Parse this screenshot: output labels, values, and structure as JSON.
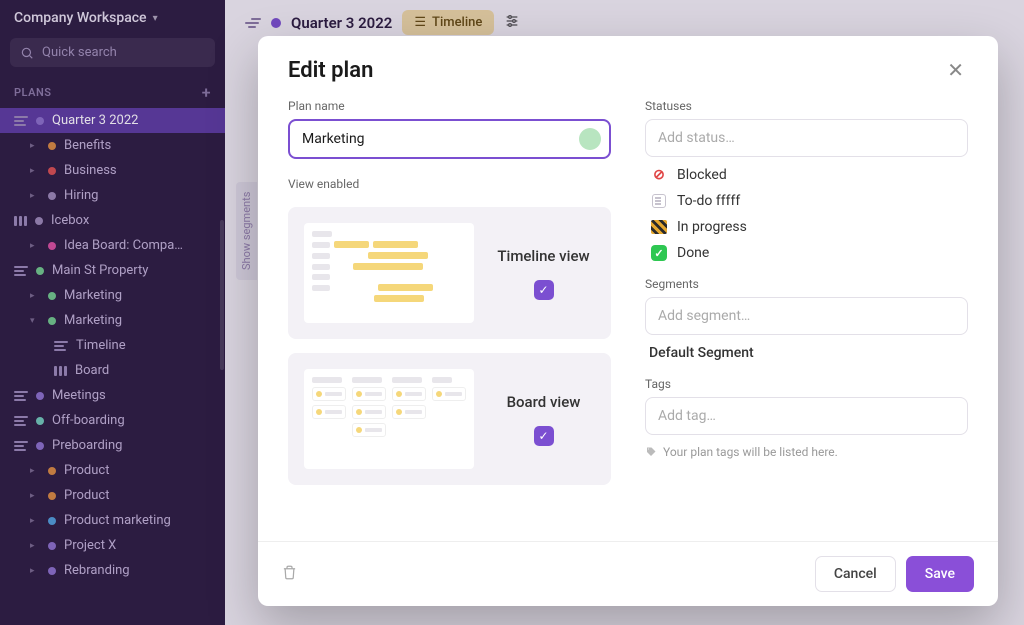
{
  "workspace": {
    "name": "Company Workspace",
    "search_placeholder": "Quick search"
  },
  "sidebar": {
    "plans_label": "PLANS",
    "items": [
      {
        "name": "Quarter 3 2022",
        "kind": "list",
        "color": "#8a6fc9",
        "active": true,
        "depth": 0
      },
      {
        "name": "Benefits",
        "kind": "dot",
        "color": "#d98a3e",
        "depth": 1
      },
      {
        "name": "Business",
        "kind": "dot",
        "color": "#d94e4e",
        "depth": 1
      },
      {
        "name": "Hiring",
        "kind": "dot",
        "color": "#9a88b5",
        "depth": 1
      },
      {
        "name": "Icebox",
        "kind": "board",
        "color": "#9a88b5",
        "depth": 0
      },
      {
        "name": "Idea Board: Compa…",
        "kind": "dot",
        "color": "#d94e9e",
        "depth": 1
      },
      {
        "name": "Main St Property",
        "kind": "list",
        "color": "#6fc98a",
        "depth": 0
      },
      {
        "name": "Marketing",
        "kind": "dot",
        "color": "#6fc98a",
        "depth": 1
      },
      {
        "name": "Marketing",
        "kind": "dot",
        "color": "#6fc98a",
        "depth": 1,
        "expanded": true
      },
      {
        "name": "Timeline",
        "kind": "list",
        "color": "",
        "depth": 2
      },
      {
        "name": "Board",
        "kind": "board",
        "color": "",
        "depth": 2
      },
      {
        "name": "Meetings",
        "kind": "list",
        "color": "#8a6fc9",
        "depth": 0
      },
      {
        "name": "Off-boarding",
        "kind": "list",
        "color": "#6fc9b8",
        "depth": 0
      },
      {
        "name": "Preboarding",
        "kind": "list",
        "color": "#8a6fc9",
        "depth": 0
      },
      {
        "name": "Product",
        "kind": "dot",
        "color": "#d98a3e",
        "depth": 1
      },
      {
        "name": "Product",
        "kind": "dot",
        "color": "#d98a3e",
        "depth": 1
      },
      {
        "name": "Product marketing",
        "kind": "dot",
        "color": "#4e9ed9",
        "depth": 1
      },
      {
        "name": "Project X",
        "kind": "dot",
        "color": "#8a6fc9",
        "depth": 1
      },
      {
        "name": "Rebranding",
        "kind": "dot",
        "color": "#8a6fc9",
        "depth": 1
      }
    ]
  },
  "topbar": {
    "crumb": "Quarter 3 2022",
    "view_label": "Timeline",
    "segments_tab": "Show segments"
  },
  "modal": {
    "title": "Edit plan",
    "plan_name_label": "Plan name",
    "plan_name_value": "Marketing",
    "view_enabled_label": "View enabled",
    "views": [
      {
        "name": "Timeline view",
        "enabled": true
      },
      {
        "name": "Board view",
        "enabled": true
      }
    ],
    "statuses_label": "Statuses",
    "status_placeholder": "Add status…",
    "statuses": [
      {
        "name": "Blocked",
        "icon": "blocked"
      },
      {
        "name": "To-do fffff",
        "icon": "todo"
      },
      {
        "name": "In progress",
        "icon": "progress"
      },
      {
        "name": "Done",
        "icon": "done"
      }
    ],
    "segments_label": "Segments",
    "segment_placeholder": "Add segment…",
    "default_segment": "Default Segment",
    "tags_label": "Tags",
    "tag_placeholder": "Add tag…",
    "tag_hint": "Your plan tags will be listed here.",
    "cancel_label": "Cancel",
    "save_label": "Save"
  }
}
